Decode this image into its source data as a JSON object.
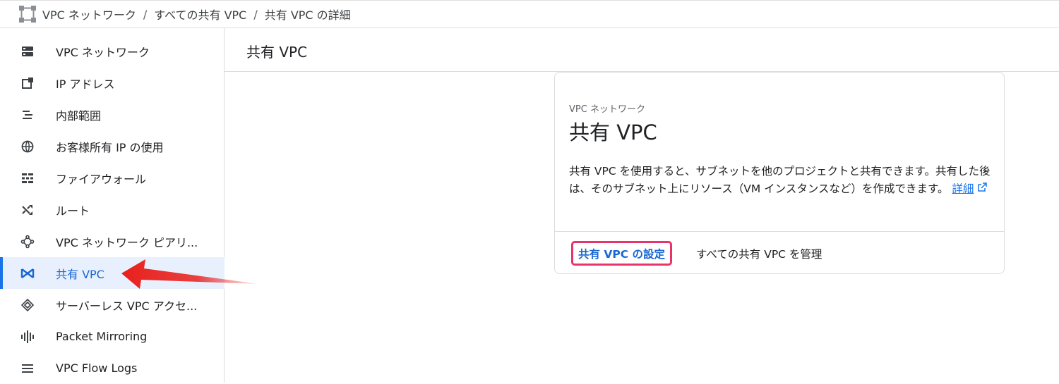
{
  "breadcrumb": {
    "items": [
      "VPC ネットワーク",
      "すべての共有 VPC",
      "共有 VPC の詳細"
    ],
    "separator": "/"
  },
  "sidebar": {
    "items": [
      {
        "label": "VPC ネットワーク",
        "icon": "vpc-network-icon"
      },
      {
        "label": "IP アドレス",
        "icon": "ip-address-icon"
      },
      {
        "label": "内部範囲",
        "icon": "internal-ranges-icon"
      },
      {
        "label": "お客様所有 IP の使用",
        "icon": "globe-icon"
      },
      {
        "label": "ファイアウォール",
        "icon": "firewall-icon"
      },
      {
        "label": "ルート",
        "icon": "routes-icon"
      },
      {
        "label": "VPC ネットワーク ピアリ...",
        "icon": "peering-icon"
      },
      {
        "label": "共有 VPC",
        "icon": "shared-vpc-icon",
        "active": true
      },
      {
        "label": "サーバーレス VPC アクセ...",
        "icon": "serverless-icon"
      },
      {
        "label": "Packet Mirroring",
        "icon": "packet-mirroring-icon"
      },
      {
        "label": "VPC Flow Logs",
        "icon": "flow-logs-icon"
      }
    ]
  },
  "header": {
    "title": "共有 VPC"
  },
  "card": {
    "overline": "VPC ネットワーク",
    "title": "共有 VPC",
    "body": "共有 VPC を使用すると、サブネットを他のプロジェクトと共有できます。共有した後は、そのサブネット上にリソース（VM インスタンスなど）を作成できます。",
    "link_label": "詳細",
    "setup_button": "共有 VPC の設定",
    "manage_button": "すべての共有 VPC を管理"
  },
  "colors": {
    "accent": "#1a73e8",
    "active_bg": "#e8f0fe",
    "highlight_border": "#e8336b",
    "arrow": "#e8201c"
  }
}
